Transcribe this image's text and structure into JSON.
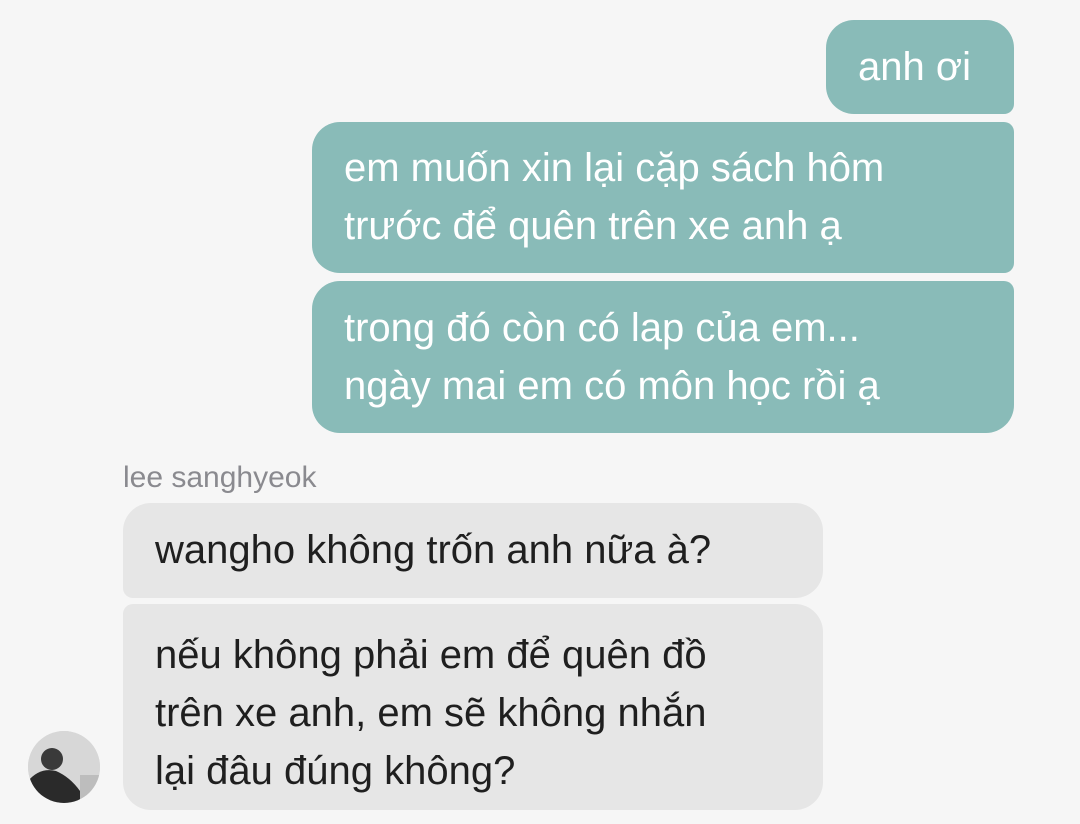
{
  "conversation": {
    "outgoing": [
      {
        "text": "anh ơi"
      },
      {
        "text": "em muốn xin lại cặp sách hôm\ntrước để quên trên xe anh ạ"
      },
      {
        "text": "trong đó còn có lap của em...\nngày mai em có môn học rồi ạ"
      }
    ],
    "incoming_sender": "lee sanghyeok",
    "incoming": [
      {
        "text": "wangho không trốn anh nữa à?"
      },
      {
        "text": "nếu không phải em để quên đồ\ntrên xe anh, em sẽ không nhắn\nlại đâu đúng không?"
      }
    ]
  },
  "colors": {
    "outgoing_bubble": "#89bbb8",
    "incoming_bubble": "#e6e6e6",
    "background": "#f6f6f6"
  }
}
